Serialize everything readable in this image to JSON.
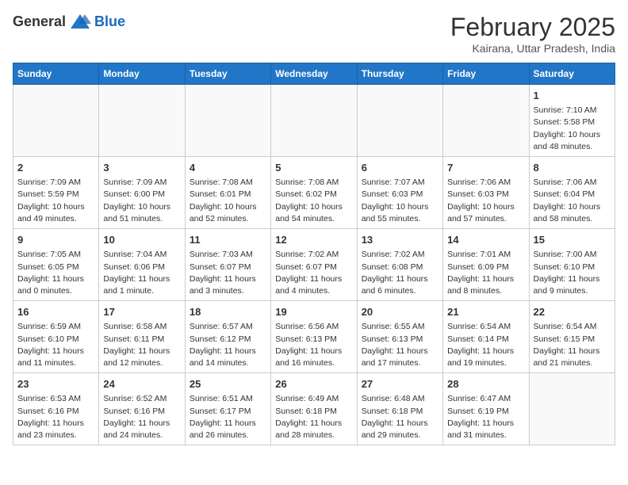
{
  "header": {
    "logo_general": "General",
    "logo_blue": "Blue",
    "month_title": "February 2025",
    "location": "Kairana, Uttar Pradesh, India"
  },
  "calendar": {
    "days_of_week": [
      "Sunday",
      "Monday",
      "Tuesday",
      "Wednesday",
      "Thursday",
      "Friday",
      "Saturday"
    ],
    "weeks": [
      [
        {
          "day": "",
          "info": ""
        },
        {
          "day": "",
          "info": ""
        },
        {
          "day": "",
          "info": ""
        },
        {
          "day": "",
          "info": ""
        },
        {
          "day": "",
          "info": ""
        },
        {
          "day": "",
          "info": ""
        },
        {
          "day": "1",
          "info": "Sunrise: 7:10 AM\nSunset: 5:58 PM\nDaylight: 10 hours\nand 48 minutes."
        }
      ],
      [
        {
          "day": "2",
          "info": "Sunrise: 7:09 AM\nSunset: 5:59 PM\nDaylight: 10 hours\nand 49 minutes."
        },
        {
          "day": "3",
          "info": "Sunrise: 7:09 AM\nSunset: 6:00 PM\nDaylight: 10 hours\nand 51 minutes."
        },
        {
          "day": "4",
          "info": "Sunrise: 7:08 AM\nSunset: 6:01 PM\nDaylight: 10 hours\nand 52 minutes."
        },
        {
          "day": "5",
          "info": "Sunrise: 7:08 AM\nSunset: 6:02 PM\nDaylight: 10 hours\nand 54 minutes."
        },
        {
          "day": "6",
          "info": "Sunrise: 7:07 AM\nSunset: 6:03 PM\nDaylight: 10 hours\nand 55 minutes."
        },
        {
          "day": "7",
          "info": "Sunrise: 7:06 AM\nSunset: 6:03 PM\nDaylight: 10 hours\nand 57 minutes."
        },
        {
          "day": "8",
          "info": "Sunrise: 7:06 AM\nSunset: 6:04 PM\nDaylight: 10 hours\nand 58 minutes."
        }
      ],
      [
        {
          "day": "9",
          "info": "Sunrise: 7:05 AM\nSunset: 6:05 PM\nDaylight: 11 hours\nand 0 minutes."
        },
        {
          "day": "10",
          "info": "Sunrise: 7:04 AM\nSunset: 6:06 PM\nDaylight: 11 hours\nand 1 minute."
        },
        {
          "day": "11",
          "info": "Sunrise: 7:03 AM\nSunset: 6:07 PM\nDaylight: 11 hours\nand 3 minutes."
        },
        {
          "day": "12",
          "info": "Sunrise: 7:02 AM\nSunset: 6:07 PM\nDaylight: 11 hours\nand 4 minutes."
        },
        {
          "day": "13",
          "info": "Sunrise: 7:02 AM\nSunset: 6:08 PM\nDaylight: 11 hours\nand 6 minutes."
        },
        {
          "day": "14",
          "info": "Sunrise: 7:01 AM\nSunset: 6:09 PM\nDaylight: 11 hours\nand 8 minutes."
        },
        {
          "day": "15",
          "info": "Sunrise: 7:00 AM\nSunset: 6:10 PM\nDaylight: 11 hours\nand 9 minutes."
        }
      ],
      [
        {
          "day": "16",
          "info": "Sunrise: 6:59 AM\nSunset: 6:10 PM\nDaylight: 11 hours\nand 11 minutes."
        },
        {
          "day": "17",
          "info": "Sunrise: 6:58 AM\nSunset: 6:11 PM\nDaylight: 11 hours\nand 12 minutes."
        },
        {
          "day": "18",
          "info": "Sunrise: 6:57 AM\nSunset: 6:12 PM\nDaylight: 11 hours\nand 14 minutes."
        },
        {
          "day": "19",
          "info": "Sunrise: 6:56 AM\nSunset: 6:13 PM\nDaylight: 11 hours\nand 16 minutes."
        },
        {
          "day": "20",
          "info": "Sunrise: 6:55 AM\nSunset: 6:13 PM\nDaylight: 11 hours\nand 17 minutes."
        },
        {
          "day": "21",
          "info": "Sunrise: 6:54 AM\nSunset: 6:14 PM\nDaylight: 11 hours\nand 19 minutes."
        },
        {
          "day": "22",
          "info": "Sunrise: 6:54 AM\nSunset: 6:15 PM\nDaylight: 11 hours\nand 21 minutes."
        }
      ],
      [
        {
          "day": "23",
          "info": "Sunrise: 6:53 AM\nSunset: 6:16 PM\nDaylight: 11 hours\nand 23 minutes."
        },
        {
          "day": "24",
          "info": "Sunrise: 6:52 AM\nSunset: 6:16 PM\nDaylight: 11 hours\nand 24 minutes."
        },
        {
          "day": "25",
          "info": "Sunrise: 6:51 AM\nSunset: 6:17 PM\nDaylight: 11 hours\nand 26 minutes."
        },
        {
          "day": "26",
          "info": "Sunrise: 6:49 AM\nSunset: 6:18 PM\nDaylight: 11 hours\nand 28 minutes."
        },
        {
          "day": "27",
          "info": "Sunrise: 6:48 AM\nSunset: 6:18 PM\nDaylight: 11 hours\nand 29 minutes."
        },
        {
          "day": "28",
          "info": "Sunrise: 6:47 AM\nSunset: 6:19 PM\nDaylight: 11 hours\nand 31 minutes."
        },
        {
          "day": "",
          "info": ""
        }
      ]
    ]
  }
}
